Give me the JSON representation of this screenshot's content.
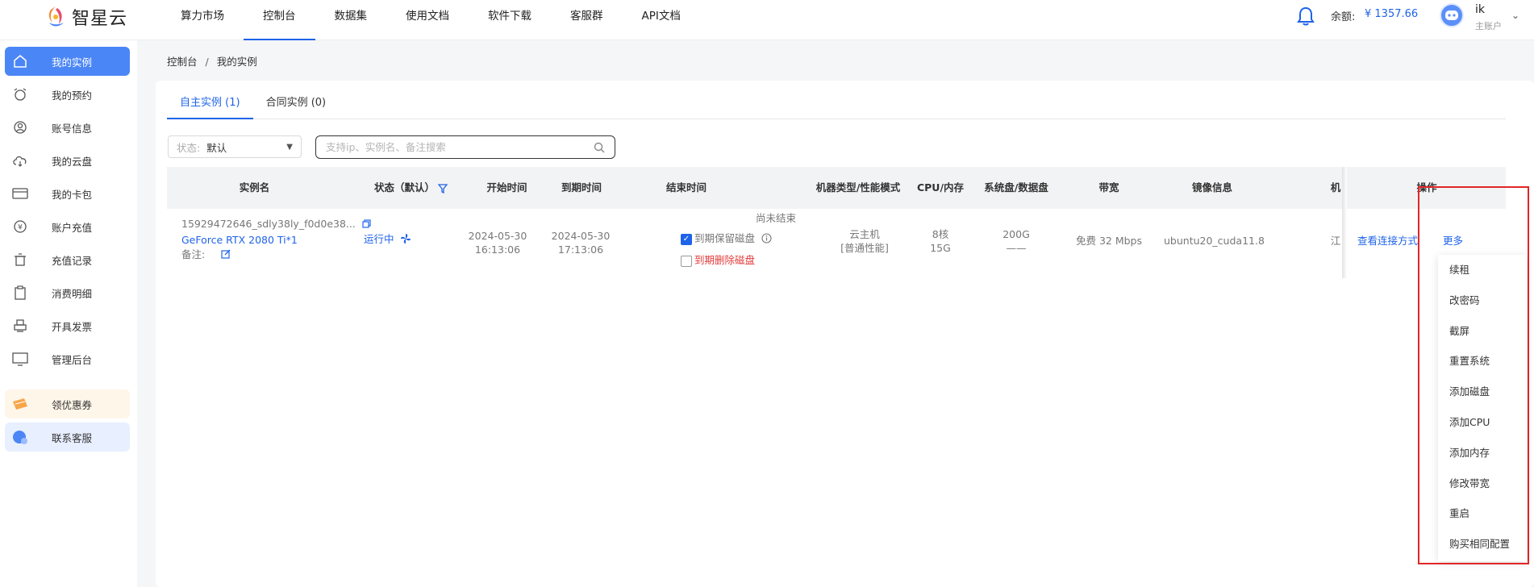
{
  "app": {
    "name": "智星云"
  },
  "topnav": {
    "items": [
      "算力市场",
      "控制台",
      "数据集",
      "使用文档",
      "软件下载",
      "客服群",
      "API文档"
    ],
    "active_index": 1
  },
  "account": {
    "balance_label": "余额:",
    "balance_value": "¥ 1357.66",
    "user_name": "ik",
    "user_role": "主账户"
  },
  "sidebar": {
    "items": [
      {
        "label": "我的实例",
        "icon": "home-icon"
      },
      {
        "label": "我的预约",
        "icon": "alarm-clock-icon"
      },
      {
        "label": "账号信息",
        "icon": "user-icon"
      },
      {
        "label": "我的云盘",
        "icon": "cloud-icon"
      },
      {
        "label": "我的卡包",
        "icon": "card-icon"
      },
      {
        "label": "账户充值",
        "icon": "coin-icon"
      },
      {
        "label": "充值记录",
        "icon": "trash-icon"
      },
      {
        "label": "消费明细",
        "icon": "clipboard-icon"
      },
      {
        "label": "开具发票",
        "icon": "printer-icon"
      },
      {
        "label": "管理后台",
        "icon": "monitor-icon"
      },
      {
        "label": "领优惠券",
        "icon": "coupon-icon"
      },
      {
        "label": "联系客服",
        "icon": "service-icon"
      }
    ],
    "active_index": 0
  },
  "breadcrumb": {
    "root": "控制台",
    "sep": "/",
    "current": "我的实例"
  },
  "tabs": [
    {
      "label": "自主实例 (1)"
    },
    {
      "label": "合同实例 (0)"
    }
  ],
  "filter": {
    "status_label": "状态:",
    "status_value": "默认"
  },
  "search": {
    "placeholder": "支持ip、实例名、备注搜索"
  },
  "table": {
    "headers": [
      "实例名",
      "状态（默认）",
      "开始时间",
      "到期时间",
      "结束时间",
      "机器类型/性能模式",
      "CPU/内存",
      "系统盘/数据盘",
      "带宽",
      "镜像信息",
      "机",
      "操作"
    ],
    "row": {
      "instance_id": "15929472646_sdly38ly_f0d0e38...",
      "gpu": "GeForce RTX 2080 Ti*1",
      "remark_label": "备注:",
      "status": "运行中",
      "start_date": "2024-05-30",
      "start_time": "16:13:06",
      "expire_date": "2024-05-30",
      "expire_time": "17:13:06",
      "end_state": "尚未结束",
      "keep_disk": "到期保留磁盘",
      "delete_disk": "到期删除磁盘",
      "machine_type": "云主机",
      "perf_mode": "[普通性能]",
      "cpu": "8核",
      "mem": "15G",
      "sys_disk": "200G",
      "data_disk": "——",
      "bandwidth": "免费 32 Mbps",
      "image": "ubuntu20_cuda11.8",
      "region": "江",
      "action_connect": "查看连接方式",
      "action_more": "更多"
    }
  },
  "more_menu": [
    "续租",
    "改密码",
    "截屏",
    "重置系统",
    "添加磁盘",
    "添加CPU",
    "添加内存",
    "修改带宽",
    "重启",
    "购买相同配置"
  ]
}
